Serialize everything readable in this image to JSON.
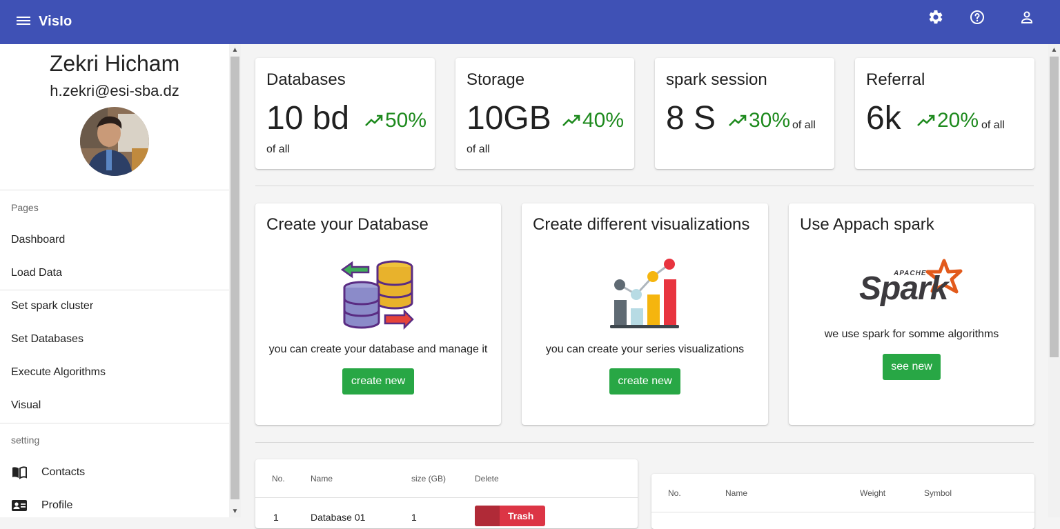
{
  "app": {
    "title": "VisIo"
  },
  "topbar": {
    "settings_icon": "gear-icon",
    "help_icon": "help-circle-icon",
    "account_icon": "person-icon"
  },
  "profile": {
    "name": "Zekri Hicham",
    "email": "h.zekri@esi-sba.dz"
  },
  "sidebar": {
    "pages_header": "Pages",
    "items": [
      {
        "label": "Dashboard"
      },
      {
        "label": "Load Data"
      },
      {
        "label": "Set spark cluster"
      },
      {
        "label": "Set Databases"
      },
      {
        "label": "Execute Algorithms"
      },
      {
        "label": "Visual"
      }
    ],
    "setting_header": "setting",
    "settings": [
      {
        "label": "Contacts",
        "icon": "book-icon"
      },
      {
        "label": "Profile",
        "icon": "contact-card-icon"
      }
    ]
  },
  "stats": [
    {
      "title": "Databases",
      "value": "10 bd",
      "trend": "50%",
      "sub": "of all"
    },
    {
      "title": "Storage",
      "value": "10GB",
      "trend": "40%",
      "sub": "of all"
    },
    {
      "title": "spark session",
      "value": "8 S",
      "trend": "30%",
      "sub": "of all"
    },
    {
      "title": "Referral",
      "value": "6k",
      "trend": "20%",
      "sub": "of all"
    }
  ],
  "features": [
    {
      "title": "Create your Database",
      "desc": "you can create your database and manage it",
      "button": "create new",
      "icon": "database-transfer-icon"
    },
    {
      "title": "Create different visualizations",
      "desc": "you can create your series visualizations",
      "button": "create new",
      "icon": "bar-chart-icon"
    },
    {
      "title": "Use Appach spark",
      "desc": "we use spark for somme algorithms",
      "button": "see new",
      "icon": "apache-spark-logo",
      "logo_text": "Spark",
      "logo_super": "APACHE"
    }
  ],
  "db_table": {
    "headers": [
      "No.",
      "Name",
      "size (GB)",
      "Delete"
    ],
    "rows": [
      {
        "no": "1",
        "name": "Database 01",
        "size": "1",
        "action": "Trash"
      }
    ]
  },
  "elem_table": {
    "headers": [
      "No.",
      "Name",
      "Weight",
      "Symbol"
    ]
  },
  "colors": {
    "appbar": "#3f51b5",
    "trend": "#1e8a1e",
    "button_green": "#28a745",
    "button_red": "#dc3545"
  }
}
